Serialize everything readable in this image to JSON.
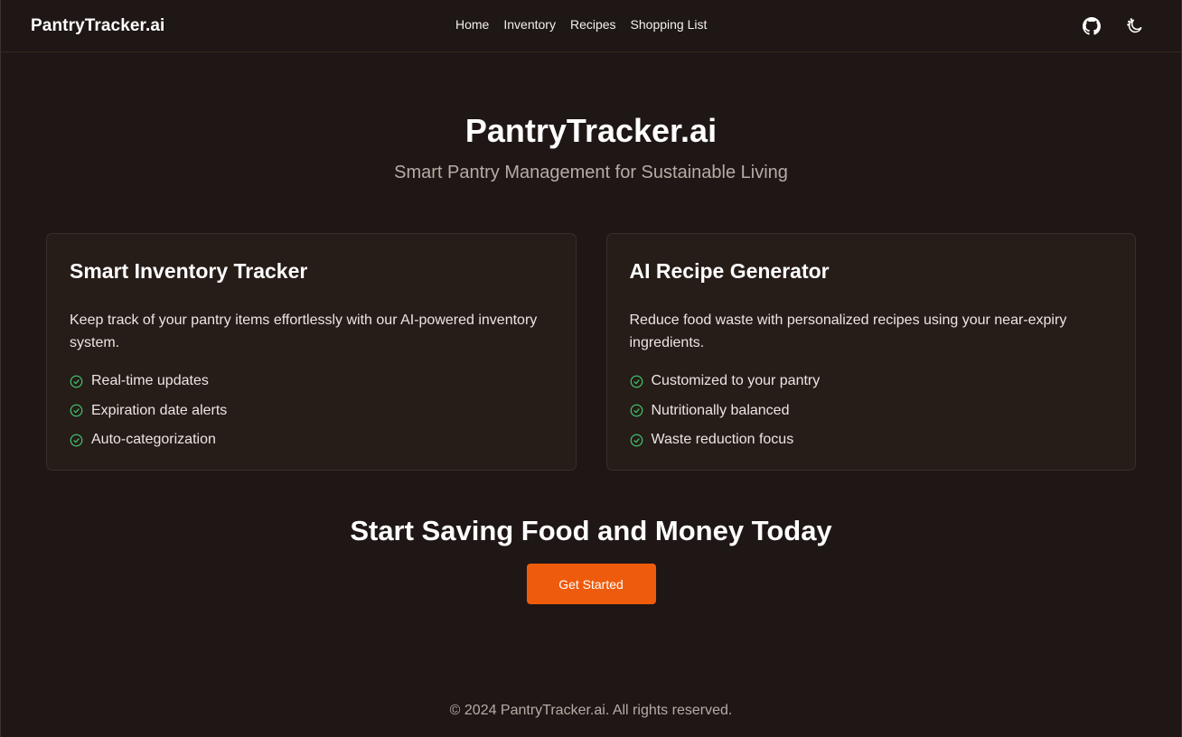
{
  "header": {
    "brand": "PantryTracker.ai",
    "nav": [
      "Home",
      "Inventory",
      "Recipes",
      "Shopping List"
    ],
    "icons": [
      "github-icon",
      "theme-toggle-icon"
    ]
  },
  "hero": {
    "title": "PantryTracker.ai",
    "subtitle": "Smart Pantry Management for Sustainable Living"
  },
  "cards": [
    {
      "title": "Smart Inventory Tracker",
      "description": "Keep track of your pantry items effortlessly with our AI-powered inventory system.",
      "features": [
        "Real-time updates",
        "Expiration date alerts",
        "Auto-categorization"
      ]
    },
    {
      "title": "AI Recipe Generator",
      "description": "Reduce food waste with personalized recipes using your near-expiry ingredients.",
      "features": [
        "Customized to your pantry",
        "Nutritionally balanced",
        "Waste reduction focus"
      ]
    }
  ],
  "cta": {
    "title": "Start Saving Food and Money Today",
    "button": "Get Started"
  },
  "footer": {
    "text": "© 2024 PantryTracker.ai. All rights reserved."
  },
  "colors": {
    "background": "#1f1715",
    "card": "#261c18",
    "accent": "#ef5b0c",
    "check": "#3fbf6a"
  }
}
